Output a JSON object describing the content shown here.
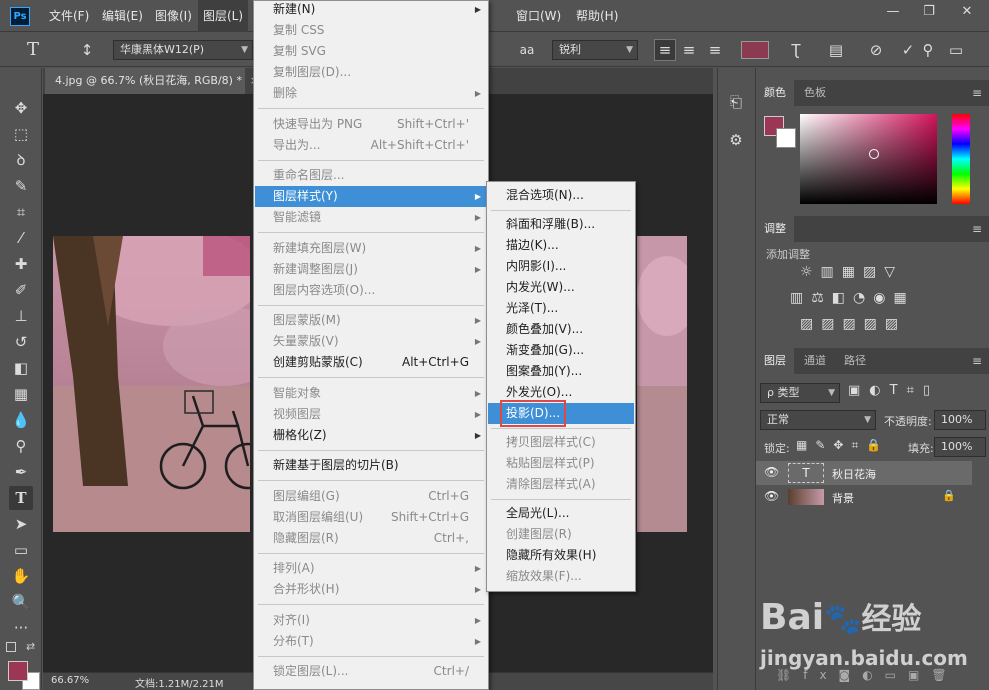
{
  "app": {
    "logo": "Ps"
  },
  "menubar": {
    "items": [
      "文件(F)",
      "编辑(E)",
      "图像(I)",
      "图层(L)"
    ],
    "right_items": [
      "窗口(W)",
      "帮助(H)"
    ],
    "window_controls": [
      "—",
      "❐",
      "✕"
    ]
  },
  "options": {
    "font_family": "华康黑体W12(P)",
    "aa_icon": "aa",
    "antialias": "锐利",
    "text_color": "#8b3a52"
  },
  "document": {
    "tab_title": "4.jpg @ 66.7% (秋日花海, RGB/8) *",
    "close": "×",
    "zoom": "66.67%",
    "doc_info": "文档:1.21M/2.21M"
  },
  "colors": {
    "foreground": "#9b3755",
    "background": "#ffffff",
    "picker_base": "#d4135b"
  },
  "color_panel": {
    "tabs": [
      "颜色",
      "色板"
    ]
  },
  "adjust_panel": {
    "tab": "调整",
    "add_label": "添加调整"
  },
  "layers_panel": {
    "tabs": [
      "图层",
      "通道",
      "路径"
    ],
    "filter_kind": "ρ 类型",
    "blend_mode": "正常",
    "opacity_label": "不透明度:",
    "opacity": "100%",
    "lock_label": "锁定:",
    "fill_label": "填充:",
    "fill": "100%",
    "layers": [
      {
        "name": "秋日花海",
        "type": "text"
      },
      {
        "name": "背景",
        "type": "image",
        "locked": true
      }
    ]
  },
  "layer_menu": {
    "items": [
      {
        "label": "新建(N)",
        "arrow": true
      },
      {
        "label": "复制 CSS",
        "disabled": true
      },
      {
        "label": "复制 SVG",
        "disabled": true
      },
      {
        "label": "复制图层(D)...",
        "disabled": true
      },
      {
        "label": "删除",
        "disabled": true,
        "arrow": true
      },
      {
        "sep": true
      },
      {
        "label": "快速导出为 PNG",
        "shortcut": "Shift+Ctrl+'",
        "disabled": true
      },
      {
        "label": "导出为...",
        "shortcut": "Alt+Shift+Ctrl+'",
        "disabled": true
      },
      {
        "sep": true
      },
      {
        "label": "重命名图层...",
        "disabled": true
      },
      {
        "label": "图层样式(Y)",
        "arrow": true,
        "highlight": true
      },
      {
        "label": "智能滤镜",
        "disabled": true,
        "arrow": true
      },
      {
        "sep": true
      },
      {
        "label": "新建填充图层(W)",
        "disabled": true,
        "arrow": true
      },
      {
        "label": "新建调整图层(J)",
        "disabled": true,
        "arrow": true
      },
      {
        "label": "图层内容选项(O)...",
        "disabled": true
      },
      {
        "sep": true
      },
      {
        "label": "图层蒙版(M)",
        "disabled": true,
        "arrow": true
      },
      {
        "label": "矢量蒙版(V)",
        "disabled": true,
        "arrow": true
      },
      {
        "label": "创建剪贴蒙版(C)",
        "shortcut": "Alt+Ctrl+G"
      },
      {
        "sep": true
      },
      {
        "label": "智能对象",
        "disabled": true,
        "arrow": true
      },
      {
        "label": "视频图层",
        "disabled": true,
        "arrow": true
      },
      {
        "label": "栅格化(Z)",
        "arrow": true
      },
      {
        "sep": true
      },
      {
        "label": "新建基于图层的切片(B)"
      },
      {
        "sep": true
      },
      {
        "label": "图层编组(G)",
        "shortcut": "Ctrl+G",
        "disabled": true
      },
      {
        "label": "取消图层编组(U)",
        "shortcut": "Shift+Ctrl+G",
        "disabled": true
      },
      {
        "label": "隐藏图层(R)",
        "shortcut": "Ctrl+,",
        "disabled": true
      },
      {
        "sep": true
      },
      {
        "label": "排列(A)",
        "disabled": true,
        "arrow": true
      },
      {
        "label": "合并形状(H)",
        "disabled": true,
        "arrow": true
      },
      {
        "sep": true
      },
      {
        "label": "对齐(I)",
        "disabled": true,
        "arrow": true
      },
      {
        "label": "分布(T)",
        "disabled": true,
        "arrow": true
      },
      {
        "sep": true
      },
      {
        "label": "锁定图层(L)...",
        "shortcut": "Ctrl+/",
        "disabled": true
      }
    ]
  },
  "style_menu": {
    "items": [
      {
        "label": "混合选项(N)..."
      },
      {
        "sep": true
      },
      {
        "label": "斜面和浮雕(B)..."
      },
      {
        "label": "描边(K)..."
      },
      {
        "label": "内阴影(I)..."
      },
      {
        "label": "内发光(W)..."
      },
      {
        "label": "光泽(T)..."
      },
      {
        "label": "颜色叠加(V)..."
      },
      {
        "label": "渐变叠加(G)..."
      },
      {
        "label": "图案叠加(Y)..."
      },
      {
        "label": "外发光(O)..."
      },
      {
        "label": "投影(D)...",
        "highlight": true,
        "boxed": true
      },
      {
        "sep": true
      },
      {
        "label": "拷贝图层样式(C)",
        "disabled": true
      },
      {
        "label": "粘贴图层样式(P)",
        "disabled": true
      },
      {
        "label": "清除图层样式(A)",
        "disabled": true
      },
      {
        "sep": true
      },
      {
        "label": "全局光(L)..."
      },
      {
        "label": "创建图层(R)",
        "disabled": true
      },
      {
        "label": "隐藏所有效果(H)"
      },
      {
        "label": "缩放效果(F)...",
        "disabled": true
      }
    ]
  },
  "watermark": {
    "brand": "Bai",
    "suffix": "经验",
    "url": "jingyan.baidu.com"
  }
}
